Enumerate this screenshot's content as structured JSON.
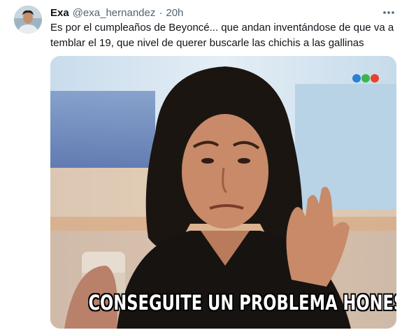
{
  "tweet": {
    "author_name": "Exa",
    "author_handle": "@exa_hernandez",
    "separator": "·",
    "time": "20h",
    "more_icon": "more-dots-icon",
    "text": "Es por el cumpleaños de Beyoncé... que andan inventándose de que va a temblar el 19, que nivel de querer buscarle las chichis a las gallinas",
    "media": {
      "caption": "CONSEGUITE UN PROBLEMA HONESTO",
      "channel_logo": "three-colored-dots-logo",
      "logo_colors": [
        "#2b7fd6",
        "#39b54a",
        "#e8412c"
      ]
    }
  }
}
